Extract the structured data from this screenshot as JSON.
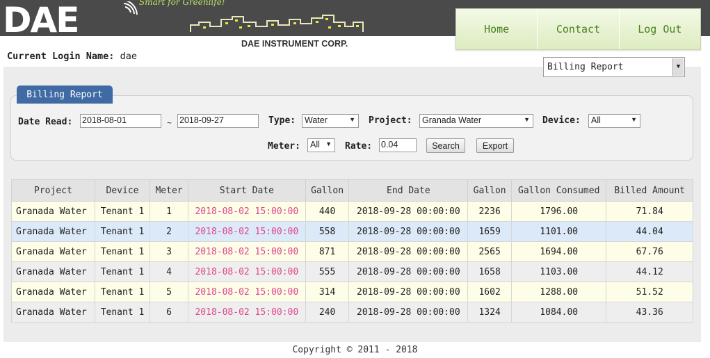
{
  "header": {
    "logo_text": "DAE",
    "tagline": "Smart for Greenlife!",
    "company": "DAE INSTRUMENT CORP."
  },
  "nav": [
    {
      "label": "Home"
    },
    {
      "label": "Contact"
    },
    {
      "label": "Log Out"
    }
  ],
  "login": {
    "label": "Current Login Name:",
    "user": "dae"
  },
  "report_select": {
    "value": "Billing Report"
  },
  "tab": {
    "label": "Billing Report"
  },
  "filters": {
    "date_read_label": "Date Read:",
    "date_from": "2018-08-01",
    "separator": "~",
    "date_to": "2018-09-27",
    "type_label": "Type:",
    "type_value": "Water",
    "project_label": "Project:",
    "project_value": "Granada Water",
    "device_label": "Device:",
    "device_value": "All",
    "meter_label": "Meter:",
    "meter_value": "All",
    "rate_label": "Rate:",
    "rate_value": "0.04",
    "search_label": "Search",
    "export_label": "Export"
  },
  "table": {
    "headers": [
      "Project",
      "Device",
      "Meter",
      "Start Date",
      "Gallon",
      "End Date",
      "Gallon",
      "Gallon Consumed",
      "Billed Amount"
    ],
    "rows": [
      [
        "Granada Water",
        "Tenant 1",
        "1",
        "2018-08-02 15:00:00",
        "440",
        "2018-09-28 00:00:00",
        "2236",
        "1796.00",
        "71.84"
      ],
      [
        "Granada Water",
        "Tenant 1",
        "2",
        "2018-08-02 15:00:00",
        "558",
        "2018-09-28 00:00:00",
        "1659",
        "1101.00",
        "44.04"
      ],
      [
        "Granada Water",
        "Tenant 1",
        "3",
        "2018-08-02 15:00:00",
        "871",
        "2018-09-28 00:00:00",
        "2565",
        "1694.00",
        "67.76"
      ],
      [
        "Granada Water",
        "Tenant 1",
        "4",
        "2018-08-02 15:00:00",
        "555",
        "2018-09-28 00:00:00",
        "1658",
        "1103.00",
        "44.12"
      ],
      [
        "Granada Water",
        "Tenant 1",
        "5",
        "2018-08-02 15:00:00",
        "314",
        "2018-09-28 00:00:00",
        "1602",
        "1288.00",
        "51.52"
      ],
      [
        "Granada Water",
        "Tenant 1",
        "6",
        "2018-08-02 15:00:00",
        "240",
        "2018-09-28 00:00:00",
        "1324",
        "1084.00",
        "43.36"
      ]
    ]
  },
  "footer": {
    "copyright": "Copyright © 2011 - 2018"
  },
  "colors": {
    "header_bg": "#4a4a4a",
    "nav_text": "#4b7f1f",
    "tab_bg": "#3f6aa3",
    "start_date_text": "#e0468b",
    "tagline": "#b7e36a"
  }
}
